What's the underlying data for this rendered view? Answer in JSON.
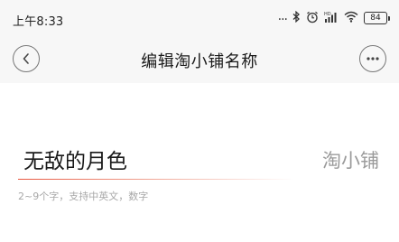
{
  "status_bar": {
    "time": "上午8:33",
    "icons": {
      "more": "...",
      "bluetooth": "bluetooth-icon",
      "alarm": "alarm-icon",
      "signal": "signal-icon",
      "wifi": "wifi-icon"
    },
    "battery_level": "84"
  },
  "nav": {
    "title": "编辑淘小铺名称",
    "back_icon": "chevron-left-icon",
    "more_icon": "more-icon"
  },
  "form": {
    "name_value": "无敌的月色",
    "suffix": "淘小铺",
    "hint": "2~9个字，支持中英文，数字",
    "underline_color": "#e8563f"
  }
}
